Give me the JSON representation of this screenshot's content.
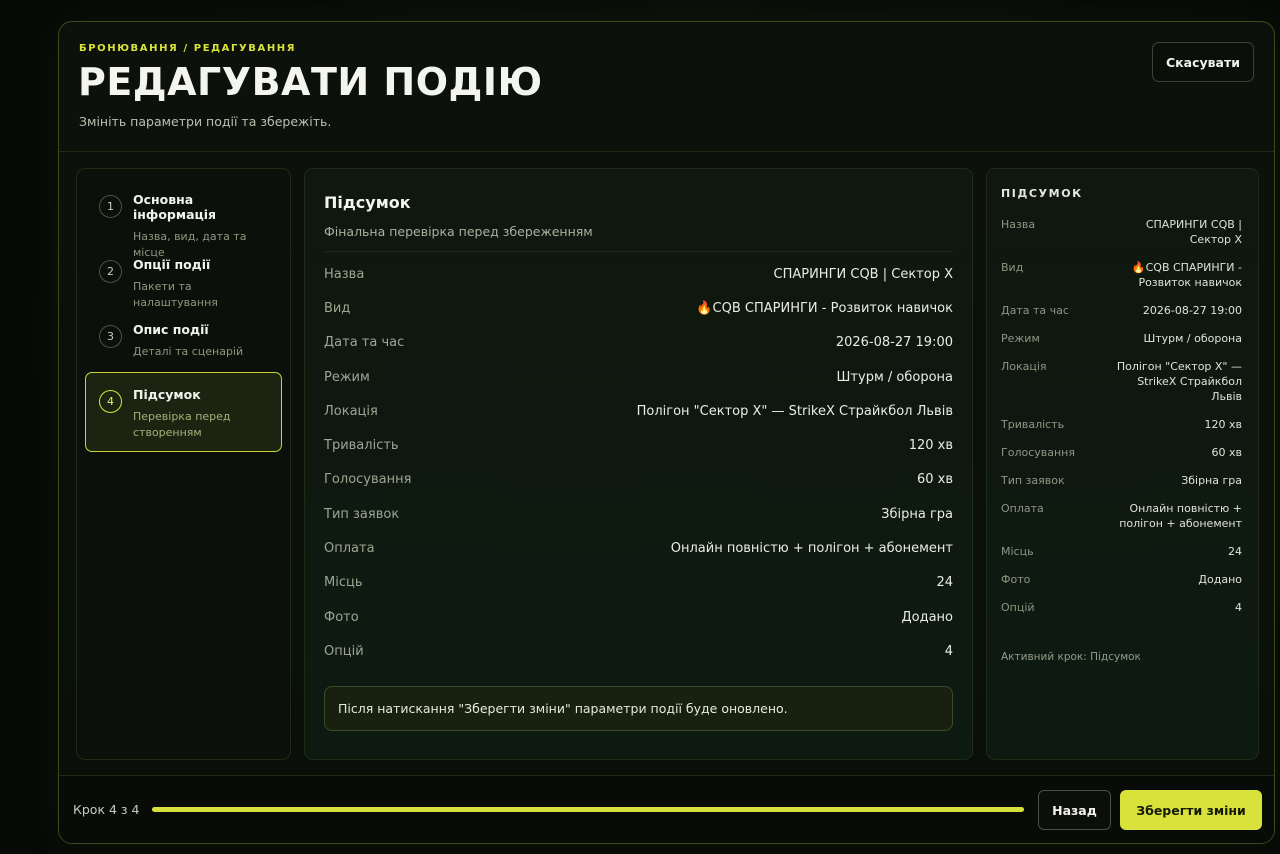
{
  "header": {
    "eyebrow": "БРОНЮВАННЯ / РЕДАГУВАННЯ",
    "title": "РЕДАГУВАТИ ПОДІЮ",
    "subtitle": "Змініть параметри події та збережіть.",
    "cancel_label": "Скасувати"
  },
  "steps": [
    {
      "num": "1",
      "title": "Основна інформація",
      "desc": "Назва, вид, дата та місце"
    },
    {
      "num": "2",
      "title": "Опції події",
      "desc": "Пакети та налаштування"
    },
    {
      "num": "3",
      "title": "Опис події",
      "desc": "Деталі та сценарій"
    },
    {
      "num": "4",
      "title": "Підсумок",
      "desc": "Перевірка перед створенням"
    }
  ],
  "summary": {
    "title": "Підсумок",
    "subtitle": "Фінальна перевірка перед збереженням",
    "rows": [
      {
        "key": "Назва",
        "value": "СПАРИНГИ CQB | Сектор Х"
      },
      {
        "key": "Вид",
        "value": "🔥CQB СПАРИНГИ - Розвиток навичок"
      },
      {
        "key": "Дата та час",
        "value": "2026-08-27 19:00"
      },
      {
        "key": "Режим",
        "value": "Штурм / оборона"
      },
      {
        "key": "Локація",
        "value": "Полігон \"Сектор Х\" — StrikeX Страйкбол Львів"
      },
      {
        "key": "Тривалість",
        "value": "120 хв"
      },
      {
        "key": "Голосування",
        "value": "60 хв"
      },
      {
        "key": "Тип заявок",
        "value": "Збірна гра"
      },
      {
        "key": "Оплата",
        "value": "Онлайн повністю + полігон + абонемент"
      },
      {
        "key": "Місць",
        "value": "24"
      },
      {
        "key": "Фото",
        "value": "Додано"
      },
      {
        "key": "Опцій",
        "value": "4"
      }
    ],
    "notice": "Після натискання \"Зберегти зміни\" параметри події буде оновлено."
  },
  "side": {
    "title": "ПІДСУМОК",
    "rows": [
      {
        "key": "Назва",
        "value": "СПАРИНГИ CQB | Сектор Х"
      },
      {
        "key": "Вид",
        "value": "🔥CQB СПАРИНГИ - Розвиток навичок"
      },
      {
        "key": "Дата та час",
        "value": "2026-08-27 19:00"
      },
      {
        "key": "Режим",
        "value": "Штурм / оборона"
      },
      {
        "key": "Локація",
        "value": "Полігон \"Сектор Х\" — StrikeX Страйкбол Львів"
      },
      {
        "key": "Тривалість",
        "value": "120 хв"
      },
      {
        "key": "Голосування",
        "value": "60 хв"
      },
      {
        "key": "Тип заявок",
        "value": "Збірна гра"
      },
      {
        "key": "Оплата",
        "value": "Онлайн повністю + полігон + абонемент"
      },
      {
        "key": "Місць",
        "value": "24"
      },
      {
        "key": "Фото",
        "value": "Додано"
      },
      {
        "key": "Опцій",
        "value": "4"
      }
    ],
    "active_step": "Активний крок: Підсумок"
  },
  "footer": {
    "step_counter": "Крок 4 з 4",
    "progress": 1.0,
    "back_label": "Назад",
    "save_label": "Зберегти зміни"
  },
  "colors": {
    "accent": "#d9e23a",
    "background": "#0a0f09"
  }
}
